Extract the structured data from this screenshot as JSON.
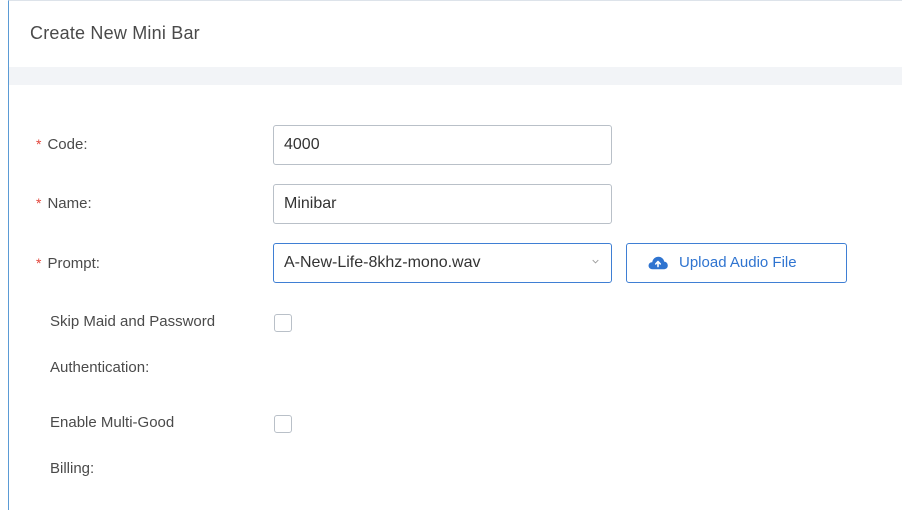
{
  "header": {
    "title": "Create New Mini Bar"
  },
  "form": {
    "code": {
      "label": "Code:",
      "value": "4000",
      "required": true
    },
    "name": {
      "label": "Name:",
      "value": "Minibar",
      "required": true
    },
    "prompt": {
      "label": "Prompt:",
      "selected": "A-New-Life-8khz-mono.wav",
      "required": true,
      "upload_button": {
        "label": "Upload Audio File",
        "icon": "cloud-upload-icon"
      }
    },
    "skip_auth": {
      "label_line1": "Skip Maid and Password",
      "label_line2": "Authentication:",
      "checked": false
    },
    "multi_good": {
      "label_line1": "Enable Multi-Good",
      "label_line2": "Billing:",
      "checked": false
    }
  },
  "colors": {
    "accent": "#3f7fd4",
    "required": "#e2463b",
    "band": "#f2f4f7"
  }
}
